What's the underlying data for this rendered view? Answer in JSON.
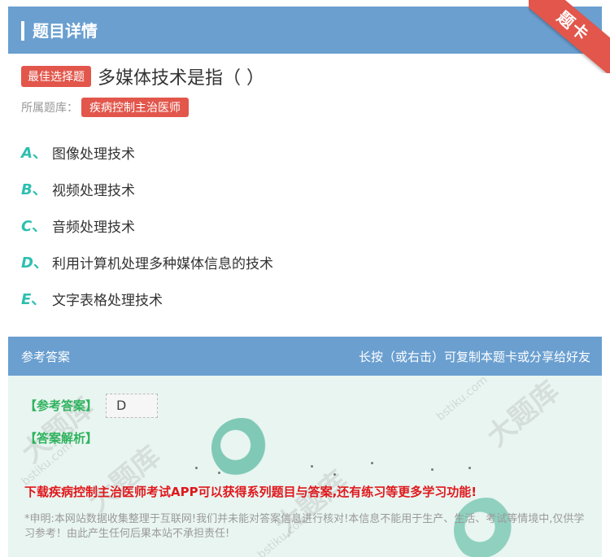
{
  "header": {
    "title": "题目详情"
  },
  "ribbon": {
    "text": "题卡"
  },
  "question": {
    "tag": "最佳选择题",
    "text": "多媒体技术是指（ ）",
    "library_label": "所属题库：",
    "library_name": "疾病控制主治医师"
  },
  "options": [
    {
      "letter": "A",
      "text": "图像处理技术"
    },
    {
      "letter": "B",
      "text": "视频处理技术"
    },
    {
      "letter": "C",
      "text": "音频处理技术"
    },
    {
      "letter": "D",
      "text": "利用计算机处理多种媒体信息的技术"
    },
    {
      "letter": "E",
      "text": "文字表格处理技术"
    }
  ],
  "answer_section": {
    "title": "参考答案",
    "hint": "长按（或右击）可复制本题卡或分享给好友",
    "answer_label": "【参考答案】",
    "answer_value": "D",
    "analysis_label": "【答案解析】",
    "promo": "下载疾病控制主治医师考试APP可以获得系列题目与答案,还有练习等更多学习功能!",
    "disclaimer": "*申明:本网站数据收集整理于互联网!我们并未能对答案信息进行核对!本信息不能用于生产、生活、考试等情境中,仅供学习参考！由此产生任何后果本站不承担责任!"
  },
  "watermark": {
    "brand": "大题库",
    "domain": "bstiku.com"
  },
  "colors": {
    "header": "#6a9fd0",
    "accent_red": "#e2564b",
    "option_letter": "#2dbfb0",
    "answer_label": "#2fb35e",
    "promo": "#e0181c"
  }
}
